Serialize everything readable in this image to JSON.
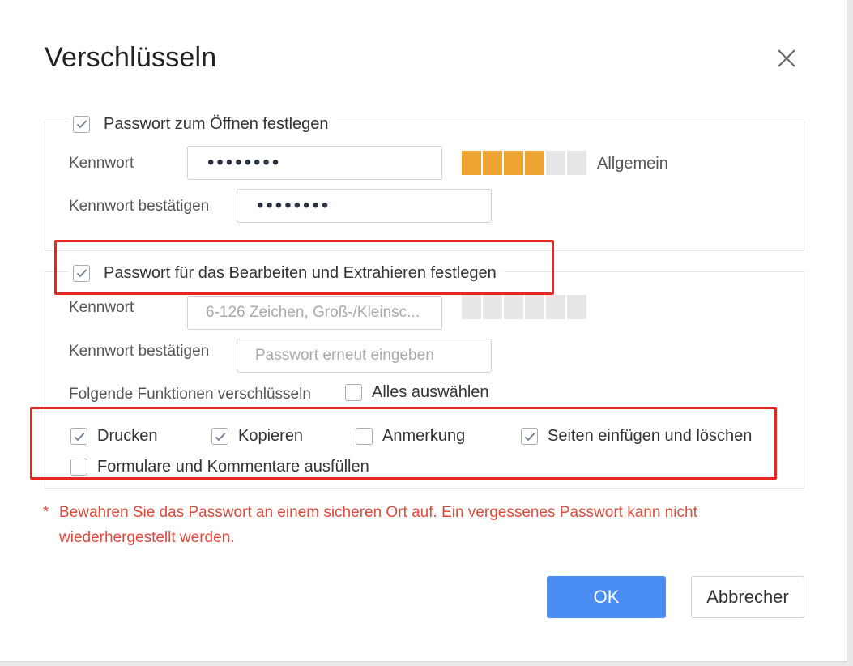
{
  "dialog": {
    "title": "Verschlüsseln",
    "close_icon": "close-icon"
  },
  "open_password": {
    "checkbox_label": "Passwort zum Öffnen festlegen",
    "checked": true,
    "password_label": "Kennwort",
    "password_value": "••••••••",
    "confirm_label": "Kennwort bestätigen",
    "confirm_value": "••••••••",
    "strength_level": 4,
    "strength_segments": 6,
    "strength_text": "Allgemein"
  },
  "edit_password": {
    "checkbox_label": "Passwort für das Bearbeiten und Extrahieren festlegen",
    "checked": true,
    "password_label": "Kennwort",
    "password_placeholder": "6-126 Zeichen, Groß-/Kleinsc...",
    "confirm_label": "Kennwort bestätigen",
    "confirm_placeholder": "Passwort erneut eingeben",
    "strength_level": 0,
    "strength_segments": 6,
    "functions_label": "Folgende Funktionen verschlüsseln",
    "select_all_label": "Alles auswählen",
    "select_all_checked": false,
    "options": [
      {
        "label": "Drucken",
        "checked": true
      },
      {
        "label": "Kopieren",
        "checked": true
      },
      {
        "label": "Anmerkung",
        "checked": false
      },
      {
        "label": "Seiten einfügen und löschen",
        "checked": true
      },
      {
        "label": "Formulare und Kommentare ausfüllen",
        "checked": false
      }
    ]
  },
  "warning": {
    "asterisk": "*",
    "text": "Bewahren Sie das Passwort an einem sicheren Ort auf. Ein vergessenes Passwort kann nicht wiederhergestellt werden."
  },
  "buttons": {
    "ok": "OK",
    "cancel": "Abbrecher"
  },
  "colors": {
    "accent": "#4a8df3",
    "strength": "#eda432",
    "warning": "#e04a3c",
    "highlight": "#e8261f"
  }
}
